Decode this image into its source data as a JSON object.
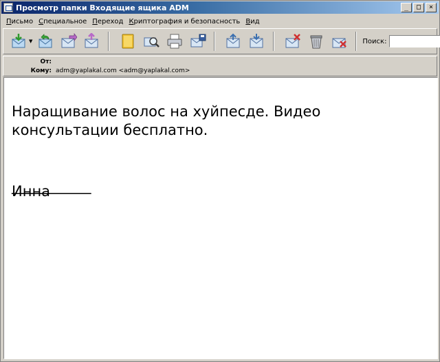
{
  "window": {
    "title": "Просмотр папки Входящие ящика ADM",
    "controls": {
      "minimize": "_",
      "maximize": "□",
      "close": "×"
    }
  },
  "menu": {
    "items": [
      "Письмо",
      "Специальное",
      "Переход",
      "Криптография и безопасность",
      "Вид"
    ]
  },
  "toolbar": {
    "icons": [
      "get-mail-icon",
      "reply-icon",
      "forward-icon",
      "compose-icon",
      "address-book-icon",
      "find-icon",
      "print-icon",
      "save-icon",
      "previous-icon",
      "next-icon",
      "delete-icon",
      "trash-icon",
      "junk-icon"
    ],
    "dropdown_arrow": "▼",
    "search_label": "Поиск:",
    "search_value": ""
  },
  "header": {
    "from_label": "От:",
    "from_value": "",
    "to_label": "Кому:",
    "to_value": "adm@yaplakal.com <adm@yaplakal.com>"
  },
  "message": {
    "body": "Наращивание волос на хуйпесде. Видео консультации бесплатно.",
    "signature_separator": "___________",
    "signature": "Инна"
  },
  "colors": {
    "window_face": "#d4d0c8",
    "titlebar_start": "#0a246a",
    "titlebar_end": "#a6caf0",
    "body_background": "#ffffff"
  }
}
